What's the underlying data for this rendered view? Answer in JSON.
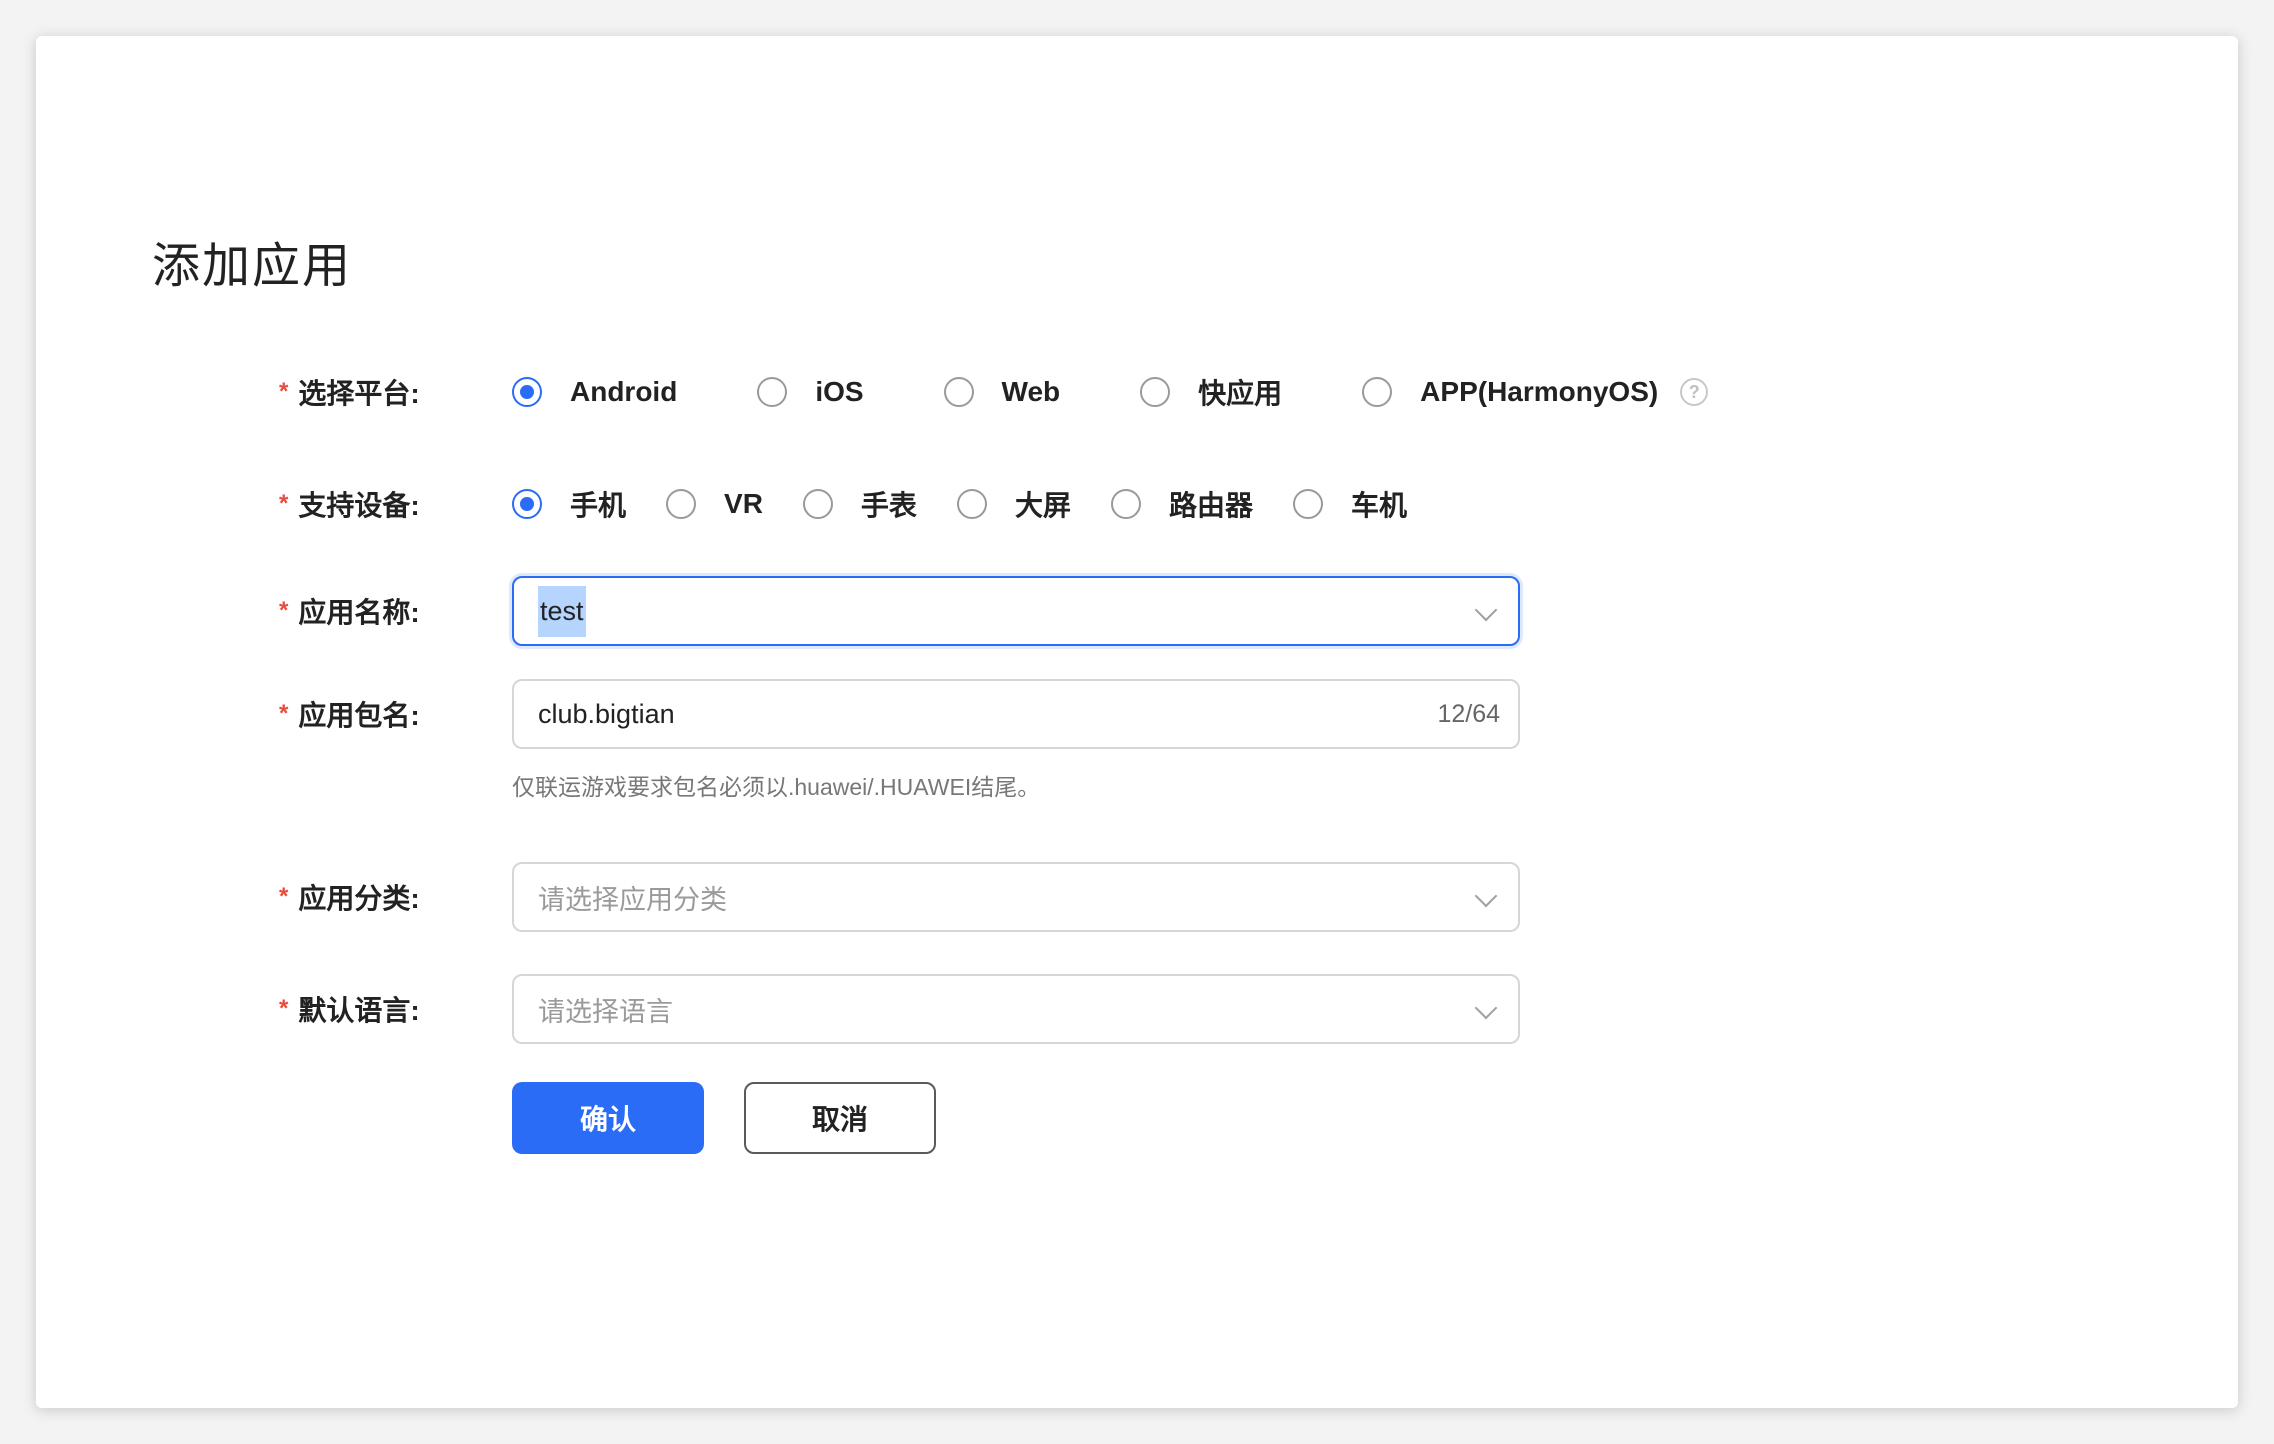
{
  "dialog": {
    "title": "添加应用"
  },
  "platform": {
    "label": "选择平台:",
    "required_mark": "*",
    "options": [
      "Android",
      "iOS",
      "Web",
      "快应用",
      "APP(HarmonyOS)"
    ],
    "selected": "Android",
    "help": "?"
  },
  "devices": {
    "label": "支持设备:",
    "required_mark": "*",
    "options": [
      "手机",
      "VR",
      "手表",
      "大屏",
      "路由器",
      "车机"
    ],
    "selected": "手机"
  },
  "app_name": {
    "label": "应用名称:",
    "required_mark": "*",
    "value": "test"
  },
  "package_name": {
    "label": "应用包名:",
    "required_mark": "*",
    "value": "club.bigtian",
    "counter": "12/64",
    "hint": "仅联运游戏要求包名必须以.huawei/.HUAWEI结尾。"
  },
  "category": {
    "label": "应用分类:",
    "required_mark": "*",
    "placeholder": "请选择应用分类"
  },
  "language": {
    "label": "默认语言:",
    "required_mark": "*",
    "placeholder": "请选择语言"
  },
  "buttons": {
    "confirm": "确认",
    "cancel": "取消"
  },
  "colors": {
    "primary": "#2a6cf6",
    "required": "#e84c3d",
    "selection": "#b5d5ff"
  }
}
